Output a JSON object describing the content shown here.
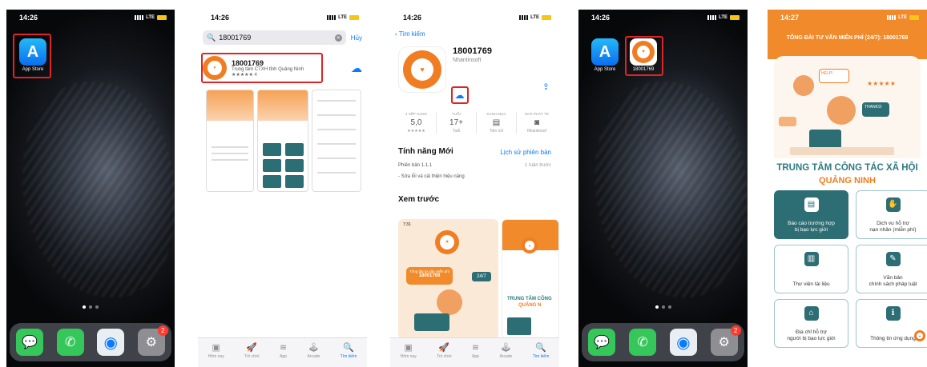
{
  "panel1": {
    "time": "14:26",
    "network": "LTE",
    "app_store_label": "App Store",
    "dock_badge": "2"
  },
  "panel2": {
    "time": "14:26",
    "network": "LTE",
    "search_value": "18001769",
    "cancel_label": "Hủy",
    "result_title": "18001769",
    "result_subtitle": "Trung tâm CTXH tỉnh Quảng Ninh",
    "result_stars": "★★★★★ 4",
    "tabs": [
      "Hôm nay",
      "Trò chơi",
      "App",
      "Arcade",
      "Tìm kiếm"
    ]
  },
  "panel3": {
    "time": "14:26",
    "network": "LTE",
    "back_label": "Tìm kiếm",
    "app_title": "18001769",
    "developer": "Nhantinsoft",
    "meta": [
      {
        "cap": "4 XẾP HẠNG",
        "big": "5,0",
        "small": "★★★★★"
      },
      {
        "cap": "TUỔI",
        "big": "17+",
        "small": "Tuổi"
      },
      {
        "cap": "DANH MỤC",
        "big": "▤",
        "small": "Tiện ích"
      },
      {
        "cap": "NHÀ PHÁT TR",
        "big": "◙",
        "small": "Nhantinsof"
      }
    ],
    "whats_new": "Tính năng Mới",
    "version_history": "Lịch sử phiên bản",
    "version": "Phiên bản 1.1.1",
    "version_age": "1 tuần trước",
    "notes": "- Sửa lỗi và cải thiện hiệu năng",
    "preview_title": "Xem trước",
    "preview_time": "7:31",
    "preview_hotline_label": "Tổng đài tư vấn miễn phí",
    "preview_number": "18001769",
    "preview_247": "24/7",
    "preview_center": "TRUNG TÂM CÔNG",
    "preview_center2": "QUẢNG N",
    "tabs": [
      "Hôm nay",
      "Trò chơi",
      "App",
      "Arcade",
      "Tìm kiếm"
    ]
  },
  "panel4": {
    "time": "14:26",
    "network": "LTE",
    "app_store_label": "App Store",
    "new_app_label": "18001769",
    "dock_badge": "2"
  },
  "panel5": {
    "time": "14:27",
    "network": "LTE",
    "hotline": "TỔNG ĐÀI TƯ VẤN MIỄN PHÍ (24/7): 18001769",
    "help_bubble": "HELP!",
    "thanks_bubble": "THANKS!",
    "heading": "TRUNG TÂM CÔNG TÁC XÃ HỘI",
    "subheading": "QUẢNG NINH",
    "cards": [
      "Báo cáo trường hợp\nbị bạo lực giới",
      "Dịch vụ hỗ trợ\nnạn nhân (miễn phí)",
      "Thư viện tài liệu",
      "Văn bản\nchính sách pháp luật",
      "Địa chỉ hỗ trợ\nngười bị bạo lực giới",
      "Thông tin ứng dụng"
    ]
  },
  "colors": {
    "highlight_box": "#e02424",
    "brand_orange": "#f07d22",
    "brand_teal": "#2d6e74",
    "ios_blue": "#0a7aff"
  }
}
